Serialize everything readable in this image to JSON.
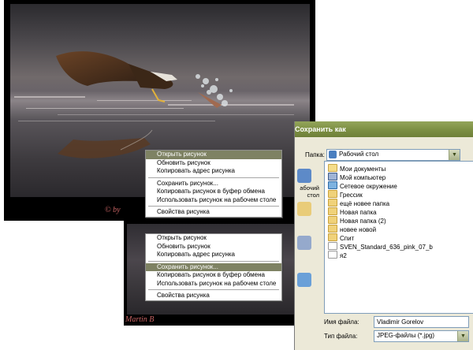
{
  "photo_main": {
    "signature": "© by"
  },
  "photo_second": {
    "signature": "Martin B"
  },
  "context_menu_1": {
    "items": [
      {
        "label": "Открыть рисунок",
        "highlighted": true
      },
      {
        "label": "Обновить рисунок",
        "highlighted": false
      },
      {
        "label": "Копировать адрес рисунка",
        "highlighted": false
      },
      {
        "label": "Сохранить рисунок...",
        "highlighted": false
      },
      {
        "label": "Копировать рисунок в буфер обмена",
        "highlighted": false
      },
      {
        "label": "Использовать рисунок на рабочем столе",
        "highlighted": false
      },
      {
        "label": "Свойства рисунка",
        "highlighted": false
      }
    ]
  },
  "context_menu_2": {
    "items": [
      {
        "label": "Открыть рисунок",
        "highlighted": false
      },
      {
        "label": "Обновить рисунок",
        "highlighted": false
      },
      {
        "label": "Копировать адрес рисунка",
        "highlighted": false
      },
      {
        "label": "Сохранить рисунок...",
        "highlighted": true
      },
      {
        "label": "Копировать рисунок в буфер обмена",
        "highlighted": false
      },
      {
        "label": "Использовать рисунок на рабочем столе",
        "highlighted": false
      },
      {
        "label": "Свойства рисунка",
        "highlighted": false
      }
    ]
  },
  "save_dialog": {
    "title": "Сохранить как",
    "folder_label": "Папка:",
    "folder_value": "Рабочий стол",
    "places": [
      "Рабочий стол",
      "Мои документы",
      "Мой компьютер"
    ],
    "files": [
      {
        "name": "Мои документы",
        "icon": "docs-folder-icon"
      },
      {
        "name": "Мой компьютер",
        "icon": "computer-icon"
      },
      {
        "name": "Сетевое окружение",
        "icon": "network-icon"
      },
      {
        "name": "Грессик",
        "icon": "folder-icon"
      },
      {
        "name": "ещё новее папка",
        "icon": "folder-icon"
      },
      {
        "name": "Новая папка",
        "icon": "folder-icon"
      },
      {
        "name": "Новая папка (2)",
        "icon": "folder-icon"
      },
      {
        "name": "новее новой",
        "icon": "folder-icon"
      },
      {
        "name": "Спит",
        "icon": "folder-icon"
      },
      {
        "name": "SVEN_Standard_636_pink_07_b",
        "icon": "file-icon"
      },
      {
        "name": "я2",
        "icon": "file-icon"
      }
    ],
    "filename_label": "Имя файла:",
    "filename_value": "Vladimir Gorelov",
    "filetype_label": "Тип файла:",
    "filetype_value": "JPEG-файлы (*.jpg)"
  }
}
